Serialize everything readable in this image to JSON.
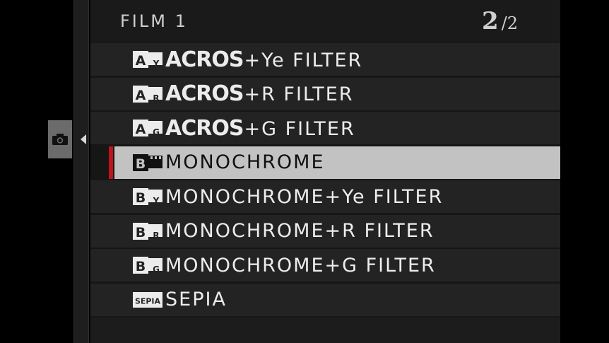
{
  "header": {
    "title": "FILM 1",
    "page_current": "2",
    "page_separator": "/",
    "page_total": "2"
  },
  "side_tab": {
    "icon": "camera-icon"
  },
  "items": [
    {
      "brand": "ACROS",
      "suffix": "+Ye FILTER",
      "icon": "acros-ye-icon",
      "badge": "A",
      "sub": "Y",
      "selected": false
    },
    {
      "brand": "ACROS",
      "suffix": "+R FILTER",
      "icon": "acros-r-icon",
      "badge": "A",
      "sub": "R",
      "selected": false
    },
    {
      "brand": "ACROS",
      "suffix": "+G FILTER",
      "icon": "acros-g-icon",
      "badge": "A",
      "sub": "G",
      "selected": false
    },
    {
      "label": "MONOCHROME",
      "icon": "monochrome-icon",
      "badge": "B",
      "sub": "",
      "selected": true
    },
    {
      "label": "MONOCHROME+Ye FILTER",
      "icon": "monochrome-ye-icon",
      "badge": "B",
      "sub": "Y",
      "selected": false
    },
    {
      "label": "MONOCHROME+R FILTER",
      "icon": "monochrome-r-icon",
      "badge": "B",
      "sub": "R",
      "selected": false
    },
    {
      "label": "MONOCHROME+G FILTER",
      "icon": "monochrome-g-icon",
      "badge": "B",
      "sub": "G",
      "selected": false
    },
    {
      "label": "SEPIA",
      "icon": "sepia-icon",
      "badge": "SEPIA",
      "sub": "",
      "selected": false
    }
  ],
  "colors": {
    "selection_marker": "#c0131b",
    "selected_bg": "#c2c2c2",
    "row_bg": "#232323"
  }
}
